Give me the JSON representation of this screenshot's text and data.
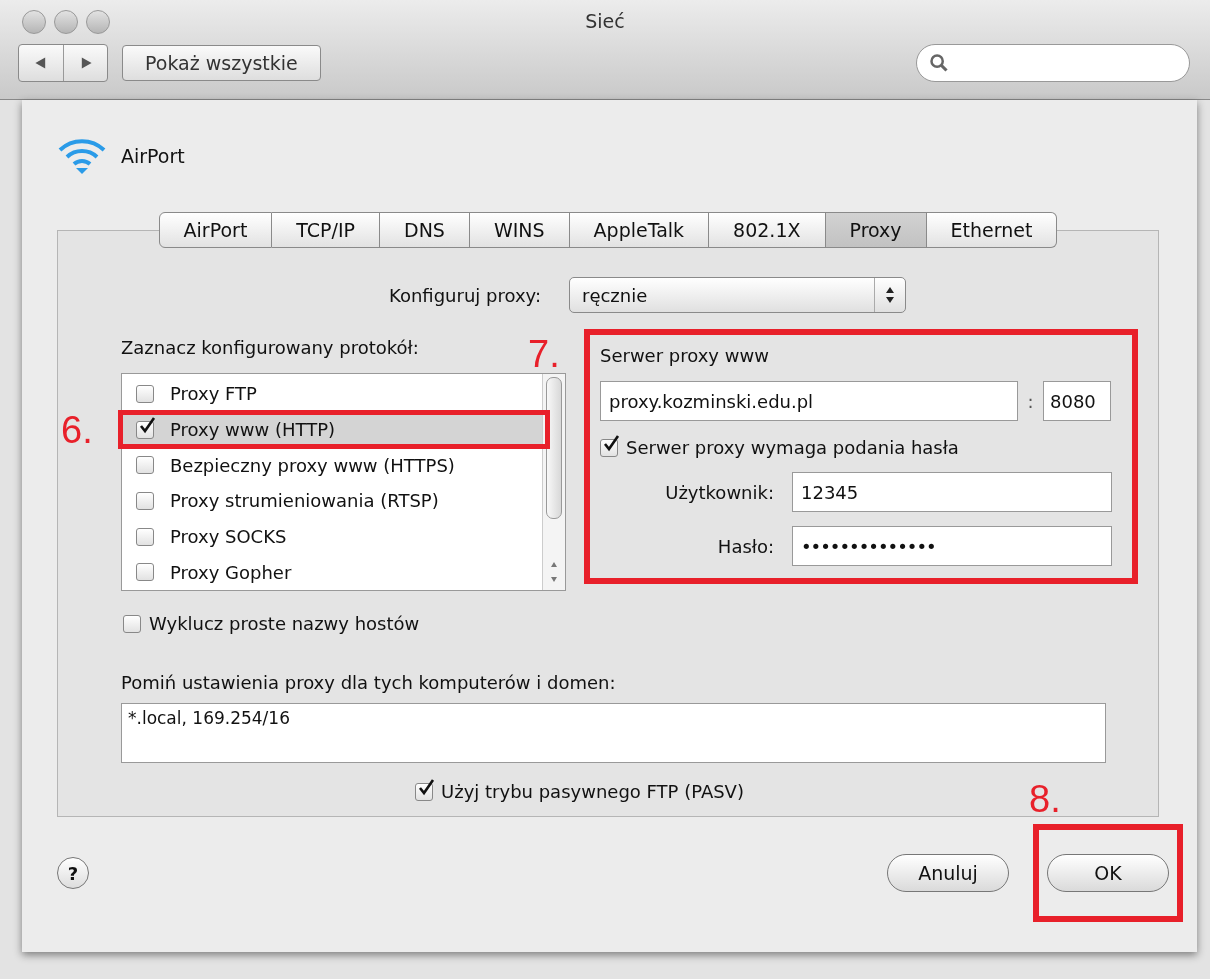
{
  "window": {
    "title": "Sieć"
  },
  "toolbar": {
    "show_all_button": "Pokaż wszystkie"
  },
  "sheet": {
    "service": "AirPort",
    "tabs": [
      {
        "label": "AirPort",
        "selected": false
      },
      {
        "label": "TCP/IP",
        "selected": false
      },
      {
        "label": "DNS",
        "selected": false
      },
      {
        "label": "WINS",
        "selected": false
      },
      {
        "label": "AppleTalk",
        "selected": false
      },
      {
        "label": "802.1X",
        "selected": false
      },
      {
        "label": "Proxy",
        "selected": true
      },
      {
        "label": "Ethernet",
        "selected": false
      }
    ],
    "configure": {
      "label": "Konfiguruj proxy:",
      "value": "ręcznie"
    },
    "protocols": {
      "label": "Zaznacz konfigurowany protokół:",
      "items": [
        {
          "label": "Proxy FTP",
          "checked": false,
          "selected": false
        },
        {
          "label": "Proxy www (HTTP)",
          "checked": true,
          "selected": true,
          "annotation": "6."
        },
        {
          "label": "Bezpieczny proxy www (HTTPS)",
          "checked": false,
          "selected": false
        },
        {
          "label": "Proxy strumieniowania (RTSP)",
          "checked": false,
          "selected": false
        },
        {
          "label": "Proxy SOCKS",
          "checked": false,
          "selected": false
        },
        {
          "label": "Proxy Gopher",
          "checked": false,
          "selected": false
        }
      ]
    },
    "exclude_simple_hostnames": {
      "label": "Wyklucz proste nazwy hostów",
      "checked": false
    },
    "server": {
      "annotation": "7.",
      "title": "Serwer proxy www",
      "host": "proxy.kozminski.edu.pl",
      "separator": ":",
      "port": "8080",
      "requires_password": {
        "label": "Serwer proxy wymaga podania hasła",
        "checked": true
      },
      "user": {
        "label": "Użytkownik:",
        "value": "12345"
      },
      "password": {
        "label": "Hasło:",
        "value": "••••••••••••••"
      }
    },
    "bypass": {
      "label": "Pomiń ustawienia proxy dla tych komputerów i domen:",
      "value": "*.local, 169.254/16"
    },
    "passive_ftp": {
      "label": "Użyj trybu pasywnego FTP (PASV)",
      "checked": true
    },
    "help_button": "?",
    "buttons": [
      {
        "label": "Anuluj"
      },
      {
        "label": "OK",
        "annotation": "8."
      }
    ]
  }
}
